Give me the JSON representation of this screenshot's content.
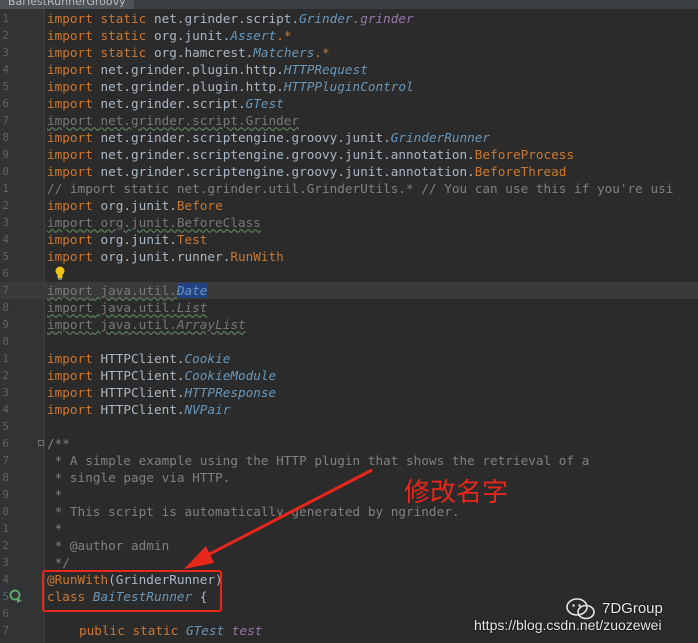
{
  "tab": {
    "title": "BaiTestRunnerGroovy"
  },
  "line_numbers": [
    "",
    "1",
    "2",
    "3",
    "4",
    "5",
    "6",
    "7",
    "8",
    "9",
    "0",
    "1",
    "2",
    "3",
    "4",
    "5",
    "6",
    "7",
    "8",
    "9",
    "0",
    "1",
    "2",
    "3",
    "4",
    "5",
    "6",
    "7",
    "8",
    "9",
    "0",
    "1",
    "2",
    "3",
    "4",
    "5",
    "6",
    "7"
  ],
  "code": {
    "l1": {
      "kw": "import",
      "mid": " static ",
      "pkg": "net.grinder.script.",
      "cls": "Grinder",
      "tail": ".grinder"
    },
    "l2": {
      "kw": "import",
      "mid": " static ",
      "pkg": "org.junit.",
      "cls": "Assert",
      "tail": ".*"
    },
    "l3": {
      "kw": "import",
      "mid": " static ",
      "pkg": "org.hamcrest.",
      "cls": "Matchers",
      "tail": ".*"
    },
    "l4": {
      "kw": "import",
      "pkg": " net.grinder.plugin.http.",
      "cls": "HTTPRequest"
    },
    "l5": {
      "kw": "import",
      "pkg": " net.grinder.plugin.http.",
      "cls": "HTTPPluginControl"
    },
    "l6": {
      "kw": "import",
      "pkg": " net.grinder.script.",
      "cls": "GTest"
    },
    "l7": {
      "text": "import net.grinder.script.Grinder"
    },
    "l8": {
      "kw": "import",
      "pkg": " net.grinder.scriptengine.groovy.junit.",
      "cls": "GrinderRunner"
    },
    "l9": {
      "kw": "import",
      "pkg": " net.grinder.scriptengine.groovy.junit.annotation.",
      "cls": "BeforeProcess"
    },
    "l10": {
      "kw": "import",
      "pkg": " net.grinder.scriptengine.groovy.junit.annotation.",
      "cls": "BeforeThread"
    },
    "l11": {
      "text": "// import static net.grinder.util.GrinderUtils.* // You can use this if you're usi"
    },
    "l12": {
      "kw": "import",
      "pkg": " org.junit.",
      "cls": "Before"
    },
    "l13": {
      "text": "import org.junit.BeforeClass"
    },
    "l14": {
      "kw": "import",
      "pkg": " org.junit.",
      "cls": "Test"
    },
    "l15": {
      "kw": "import",
      "pkg": " org.junit.runner.",
      "cls": "RunWith"
    },
    "l17": {
      "kw": "import",
      "pkg": " java.util.",
      "cls": "Date"
    },
    "l18": {
      "kw": "import",
      "pkg": " java.util.",
      "cls": "List"
    },
    "l19": {
      "kw": "import",
      "pkg": " java.util.",
      "cls": "ArrayList"
    },
    "l21": {
      "kw": "import",
      "pkg": " HTTPClient.",
      "cls": "Cookie"
    },
    "l22": {
      "kw": "import",
      "pkg": " HTTPClient.",
      "cls": "CookieModule"
    },
    "l23": {
      "kw": "import",
      "pkg": " HTTPClient.",
      "cls": "HTTPResponse"
    },
    "l24": {
      "kw": "import",
      "pkg": " HTTPClient.",
      "cls": "NVPair"
    },
    "l26": "/**",
    "l27": " * A simple example using the HTTP plugin that shows the retrieval of a",
    "l28": " * single page via HTTP.",
    "l29": " *",
    "l30": " * This script is automatically generated by ngrinder.",
    "l31": " *",
    "l32": " * @author admin",
    "l33": " */",
    "l34": {
      "ann": "@RunWith",
      "rest": "(GrinderRunner)"
    },
    "l35": {
      "kw": "class",
      "name": " BaiTestRunner",
      "brace": " {"
    },
    "l37": {
      "kw": "public static",
      "type": " GTest",
      "field": " test"
    }
  },
  "callout": "修改名字",
  "watermark": {
    "brand": "7DGroup",
    "url": "https://blog.csdn.net/zuozewei"
  },
  "colors": {
    "accent_red": "#e8261c",
    "background": "#2b2b2b",
    "keyword": "#cc7832"
  }
}
